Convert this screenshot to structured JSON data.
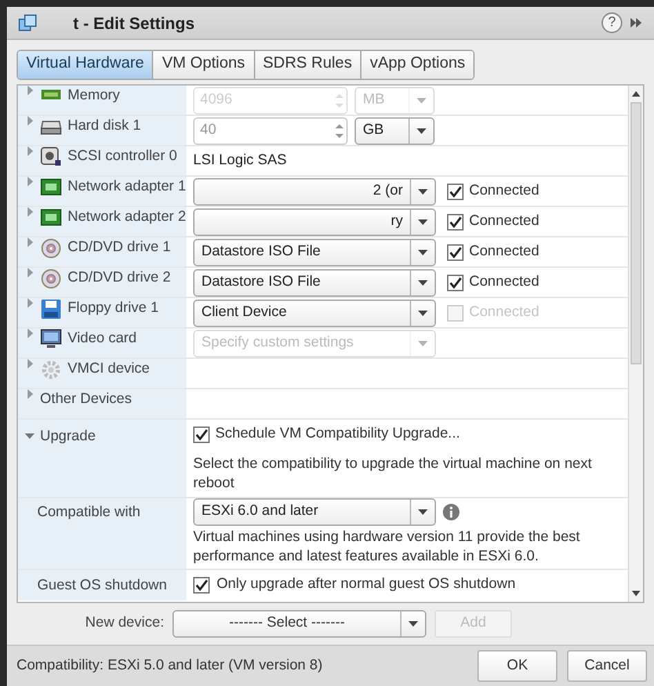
{
  "window": {
    "title": "t - Edit Settings",
    "help": "?"
  },
  "tabs": [
    {
      "label": "Virtual Hardware",
      "selected": true
    },
    {
      "label": "VM Options",
      "selected": false
    },
    {
      "label": "SDRS Rules",
      "selected": false
    },
    {
      "label": "vApp Options",
      "selected": false
    }
  ],
  "hardware": [
    {
      "kind": "spinner",
      "label": "Memory",
      "value": "4096",
      "unit": "MB",
      "disabled": true
    },
    {
      "kind": "spinner",
      "label": "Hard disk 1",
      "value": "40",
      "unit": "GB",
      "disabled": false
    },
    {
      "kind": "text",
      "label": "SCSI controller 0",
      "value": "LSI Logic SAS"
    },
    {
      "kind": "select",
      "label": "Network adapter 1",
      "value": "2 (or",
      "connect": {
        "label": "Connected",
        "checked": true,
        "disabled": false
      }
    },
    {
      "kind": "select",
      "label": "Network adapter 2",
      "value": "ry",
      "connect": {
        "label": "Connected",
        "checked": true,
        "disabled": false
      }
    },
    {
      "kind": "select",
      "label": "CD/DVD drive 1",
      "value": "Datastore ISO File",
      "connect": {
        "label": "Connected",
        "checked": true,
        "disabled": false
      }
    },
    {
      "kind": "select",
      "label": "CD/DVD drive 2",
      "value": "Datastore ISO File",
      "connect": {
        "label": "Connected",
        "checked": true,
        "disabled": false
      }
    },
    {
      "kind": "select",
      "label": "Floppy drive 1",
      "value": "Client Device",
      "connect": {
        "label": "Connected",
        "checked": false,
        "disabled": true
      }
    },
    {
      "kind": "select",
      "label": "Video card",
      "placeholder": "Specify custom settings",
      "disabled": true
    },
    {
      "kind": "empty",
      "label": "VMCI device"
    },
    {
      "kind": "empty",
      "label": "Other Devices"
    }
  ],
  "upgrade": {
    "label": "Upgrade",
    "expanded": true,
    "schedule": {
      "label": "Schedule VM Compatibility Upgrade...",
      "checked": true
    },
    "note": "Select the compatibility to upgrade the virtual machine on next reboot",
    "compatible_label": "Compatible with",
    "compatible_value": "ESXi 6.0 and later",
    "compatible_note": "Virtual machines using hardware version 11 provide the best performance and latest features available in ESXi 6.0.",
    "guest_label": "Guest OS shutdown",
    "guest": {
      "label": "Only upgrade after normal guest OS shutdown",
      "checked": true
    }
  },
  "new_device": {
    "label": "New device:",
    "value": "------- Select -------",
    "add": {
      "label": "Add",
      "disabled": true
    }
  },
  "footer": {
    "compatibility": "Compatibility: ESXi 5.0 and later (VM version 8)",
    "buttons": [
      "OK",
      "Cancel"
    ]
  }
}
